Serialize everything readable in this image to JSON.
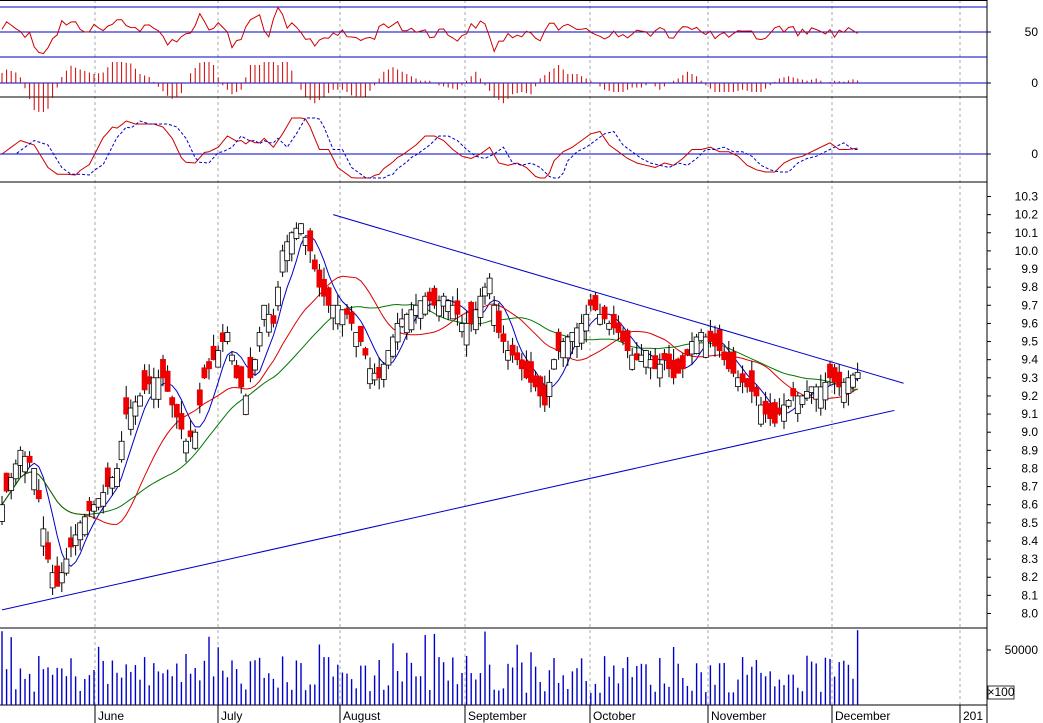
{
  "chart_data": {
    "type": "candlestick",
    "x_month_labels": [
      "June",
      "July",
      "August",
      "September",
      "October",
      "November",
      "December",
      "201"
    ],
    "main_panel": {
      "ylim": [
        7.92,
        10.38
      ],
      "y_ticks": [
        "10.3",
        "10.2",
        "10.1",
        "10.0",
        "9.9",
        "9.8",
        "9.7",
        "9.6",
        "9.5",
        "9.4",
        "9.3",
        "9.2",
        "9.1",
        "9.0",
        "8.9",
        "8.8",
        "8.7",
        "8.6",
        "8.5",
        "8.4",
        "8.3",
        "8.2",
        "8.1",
        "8.0"
      ],
      "close_trend": [
        [
          0,
          8.6
        ],
        [
          4,
          8.9
        ],
        [
          7,
          8.8
        ],
        [
          10,
          8.3
        ],
        [
          12,
          8.15
        ],
        [
          14,
          8.3
        ],
        [
          17,
          8.5
        ],
        [
          20,
          8.6
        ],
        [
          23,
          8.7
        ],
        [
          25,
          8.8
        ],
        [
          27,
          9.1
        ],
        [
          30,
          9.2
        ],
        [
          33,
          9.3
        ],
        [
          35,
          9.3
        ],
        [
          37,
          9.15
        ],
        [
          40,
          8.95
        ],
        [
          42,
          9.0
        ],
        [
          44,
          9.3
        ],
        [
          47,
          9.45
        ],
        [
          49,
          9.55
        ],
        [
          51,
          9.3
        ],
        [
          53,
          9.2
        ],
        [
          55,
          9.4
        ],
        [
          57,
          9.7
        ],
        [
          59,
          9.6
        ],
        [
          61,
          10.0
        ],
        [
          63,
          10.1
        ],
        [
          65,
          10.15
        ],
        [
          67,
          10.0
        ],
        [
          69,
          9.8
        ],
        [
          71,
          9.7
        ],
        [
          73,
          9.7
        ],
        [
          75,
          9.65
        ],
        [
          78,
          9.5
        ],
        [
          80,
          9.35
        ],
        [
          82,
          9.3
        ],
        [
          84,
          9.45
        ],
        [
          86,
          9.6
        ],
        [
          88,
          9.65
        ],
        [
          90,
          9.7
        ],
        [
          92,
          9.75
        ],
        [
          94,
          9.7
        ],
        [
          96,
          9.75
        ],
        [
          98,
          9.7
        ],
        [
          100,
          9.6
        ],
        [
          102,
          9.6
        ],
        [
          104,
          9.75
        ],
        [
          106,
          9.85
        ],
        [
          108,
          9.55
        ],
        [
          110,
          9.45
        ],
        [
          112,
          9.4
        ],
        [
          114,
          9.3
        ],
        [
          116,
          9.25
        ],
        [
          118,
          9.15
        ],
        [
          120,
          9.4
        ],
        [
          122,
          9.5
        ],
        [
          124,
          9.55
        ],
        [
          126,
          9.6
        ],
        [
          128,
          9.7
        ],
        [
          130,
          9.65
        ],
        [
          132,
          9.6
        ],
        [
          134,
          9.55
        ],
        [
          136,
          9.45
        ],
        [
          138,
          9.4
        ],
        [
          140,
          9.45
        ],
        [
          142,
          9.35
        ],
        [
          144,
          9.4
        ],
        [
          146,
          9.3
        ],
        [
          148,
          9.35
        ],
        [
          150,
          9.5
        ],
        [
          152,
          9.55
        ],
        [
          154,
          9.5
        ],
        [
          156,
          9.45
        ],
        [
          158,
          9.35
        ],
        [
          160,
          9.3
        ],
        [
          162,
          9.25
        ],
        [
          164,
          9.2
        ],
        [
          166,
          9.1
        ],
        [
          168,
          9.05
        ],
        [
          170,
          9.15
        ],
        [
          172,
          9.2
        ],
        [
          174,
          9.2
        ],
        [
          176,
          9.25
        ],
        [
          178,
          9.25
        ],
        [
          180,
          9.3
        ],
        [
          182,
          9.25
        ],
        [
          184,
          9.3
        ],
        [
          186,
          9.33
        ]
      ],
      "trendlines": [
        {
          "from": [
            72,
            10.2
          ],
          "to": [
            196,
            9.27
          ],
          "color": "#0000c8"
        },
        {
          "from": [
            0,
            8.02
          ],
          "to": [
            194,
            9.12
          ],
          "color": "#0000c8"
        }
      ],
      "ma_colors": {
        "fast": "#0000c8",
        "mid": "#dd0000",
        "slow": "#007700"
      }
    },
    "rsi_panel": {
      "tick": "50",
      "color": "#cc0000"
    },
    "hist_panel": {
      "tick": "0",
      "color": "#cc0000"
    },
    "macd_panel": {
      "tick": "0",
      "line_color": "#cc0000",
      "signal_color": "#0000c8"
    },
    "volume_panel": {
      "tick": "50000",
      "unit": "×100",
      "color": "#0000c8"
    },
    "candles_up_color": "#ffffff",
    "candles_down_color": "#ee0000"
  }
}
